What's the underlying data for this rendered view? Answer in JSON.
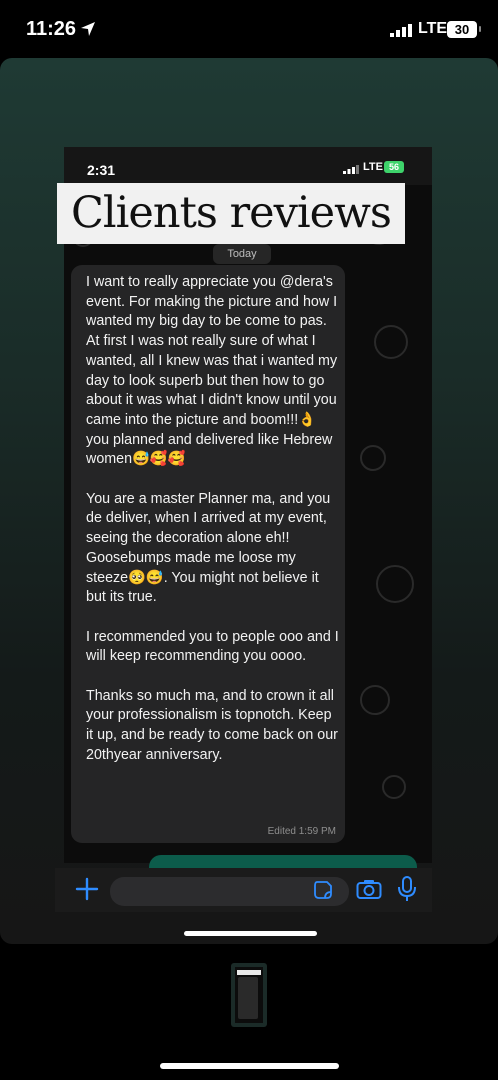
{
  "status_bar": {
    "time": "11:26",
    "network": "LTE",
    "battery": "30"
  },
  "screenshot": {
    "status_bar": {
      "time": "2:31",
      "network": "LTE",
      "battery": "56"
    },
    "title_banner": "Clients reviews",
    "date_chip": "Today",
    "message": {
      "paragraphs": [
        "I want to really appreciate you @dera's event. For making the picture and how I wanted my big day to be come to pas. At first I was not really sure of  what I wanted, all I knew was that i wanted my day to look superb but then how to go about it was what I didn't know until you came into the picture and boom!!!👌 you planned and delivered like Hebrew women😅🥰🥰",
        "You are a master Planner ma, and you de deliver, when I arrived at my event, seeing the decoration alone eh!! Goosebumps made me loose my steeze🥺😅. You might not believe it but its true.",
        "I recommended you to people ooo and I will keep recommending you oooo.",
        "Thanks so much ma, and to crown it all your professionalism is topnotch. Keep it up,  and be ready to come back on our 20thyear anniversary."
      ],
      "edited_label": "Edited",
      "edited_time": "1:59 PM"
    }
  },
  "icons": {
    "location_arrow": "location-arrow-icon",
    "plus": "plus-icon",
    "sticker": "sticker-icon",
    "camera": "camera-icon",
    "mic": "microphone-icon"
  },
  "colors": {
    "accent_blue": "#2f8cff",
    "bubble_bg": "#252526",
    "chat_green": "#0c5c4b"
  }
}
